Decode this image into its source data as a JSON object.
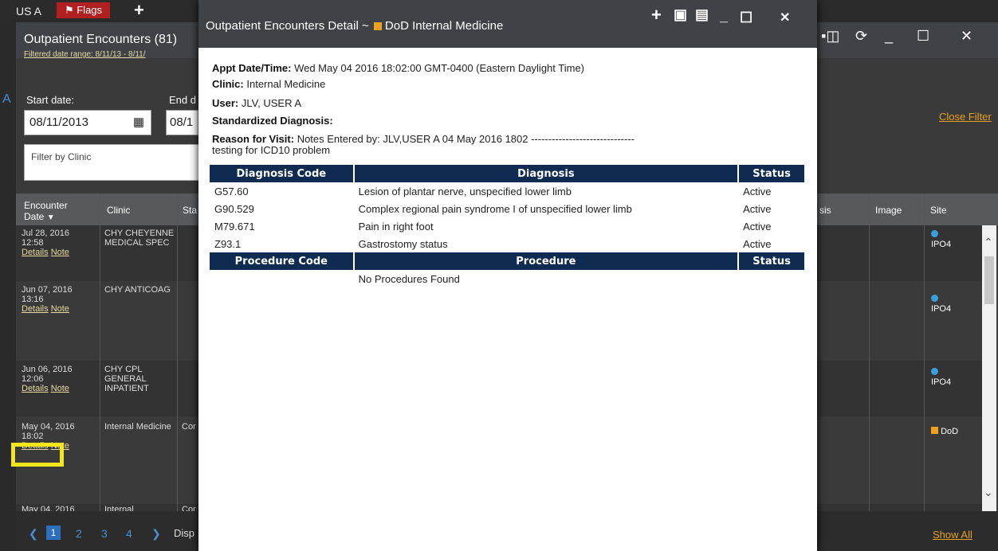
{
  "top_bar": {
    "user": "US A",
    "flags_label": "Flags",
    "add_symbol": "+"
  },
  "widget": {
    "title": "Outpatient Encounters (81)",
    "filtered_range": "Filtered date range: 8/11/13 - 8/11/",
    "close_filter": "Close Filter",
    "start_date_label": "Start date:",
    "start_date_value": "08/11/2013",
    "end_date_label": "End d",
    "end_date_value": "08/1",
    "clinic_filter_placeholder": "Filter by Clinic"
  },
  "table": {
    "headers": {
      "date": "Encounter Date",
      "clinic": "Clinic",
      "status": "Sta",
      "diagnosis": "sis",
      "image": "Image",
      "site": "Site"
    },
    "rows": [
      {
        "date": "Jul 28, 2016 12:58",
        "clinic": "CHY CHEYENNE MEDICAL SPEC",
        "status": "",
        "site": "IPO4",
        "site_marker": "dot"
      },
      {
        "date": "Jun 07, 2016 13:16",
        "clinic": "CHY ANTICOAG",
        "status": "",
        "site": "IPO4",
        "site_marker": "dot"
      },
      {
        "date": "Jun 06, 2016 12:06",
        "clinic": "CHY CPL GENERAL INPATIENT",
        "status": "",
        "site": "IPO4",
        "site_marker": "dot"
      },
      {
        "date": "May 04, 2016 18:02",
        "clinic": "Internal Medicine",
        "status": "Cor",
        "site": "DoD",
        "site_marker": "square"
      },
      {
        "date": "May 04, 2016",
        "clinic": "Internal",
        "status": "Cor",
        "site": "",
        "site_marker": "square"
      }
    ],
    "details_link": "Details",
    "note_link": "Note"
  },
  "pagination": {
    "pages": [
      "1",
      "2",
      "3",
      "4"
    ],
    "current": "1",
    "display_text": "Disp",
    "show_all": "Show All"
  },
  "modal": {
    "title": "Outpatient Encounters Detail ~",
    "title_source": "DoD Internal Medicine",
    "fields": {
      "appt_label": "Appt Date/Time:",
      "appt_value": "Wed May 04 2016 18:02:00 GMT-0400 (Eastern Daylight Time)",
      "clinic_label": "Clinic:",
      "clinic_value": "Internal Medicine",
      "user_label": "User:",
      "user_value": "JLV, USER A",
      "std_diag_label": "Standardized Diagnosis:",
      "reason_label": "Reason for Visit:",
      "reason_value": "Notes Entered by: JLV,USER A 04 May 2016 1802 ------------------------------",
      "reason_value_2": "testing for ICD10 problem"
    },
    "diagnosis_headers": [
      "Diagnosis Code",
      "Diagnosis",
      "Status"
    ],
    "diagnoses": [
      {
        "code": "G57.60",
        "desc": "Lesion of plantar nerve, unspecified lower limb",
        "status": "Active"
      },
      {
        "code": "G90.529",
        "desc": "Complex regional pain syndrome I of unspecified lower limb",
        "status": "Active"
      },
      {
        "code": "M79.671",
        "desc": "Pain in right foot",
        "status": "Active"
      },
      {
        "code": "Z93.1",
        "desc": "Gastrostomy status",
        "status": "Active"
      }
    ],
    "procedure_headers": [
      "Procedure Code",
      "Procedure",
      "Status"
    ],
    "procedures_empty": "No Procedures Found"
  },
  "colors": {
    "modal_header": "#0f2b52",
    "accent_orange": "#e6a21a",
    "flag_red": "#b02020",
    "highlight": "#f5e51d",
    "site_dot": "#3aa0e0"
  }
}
